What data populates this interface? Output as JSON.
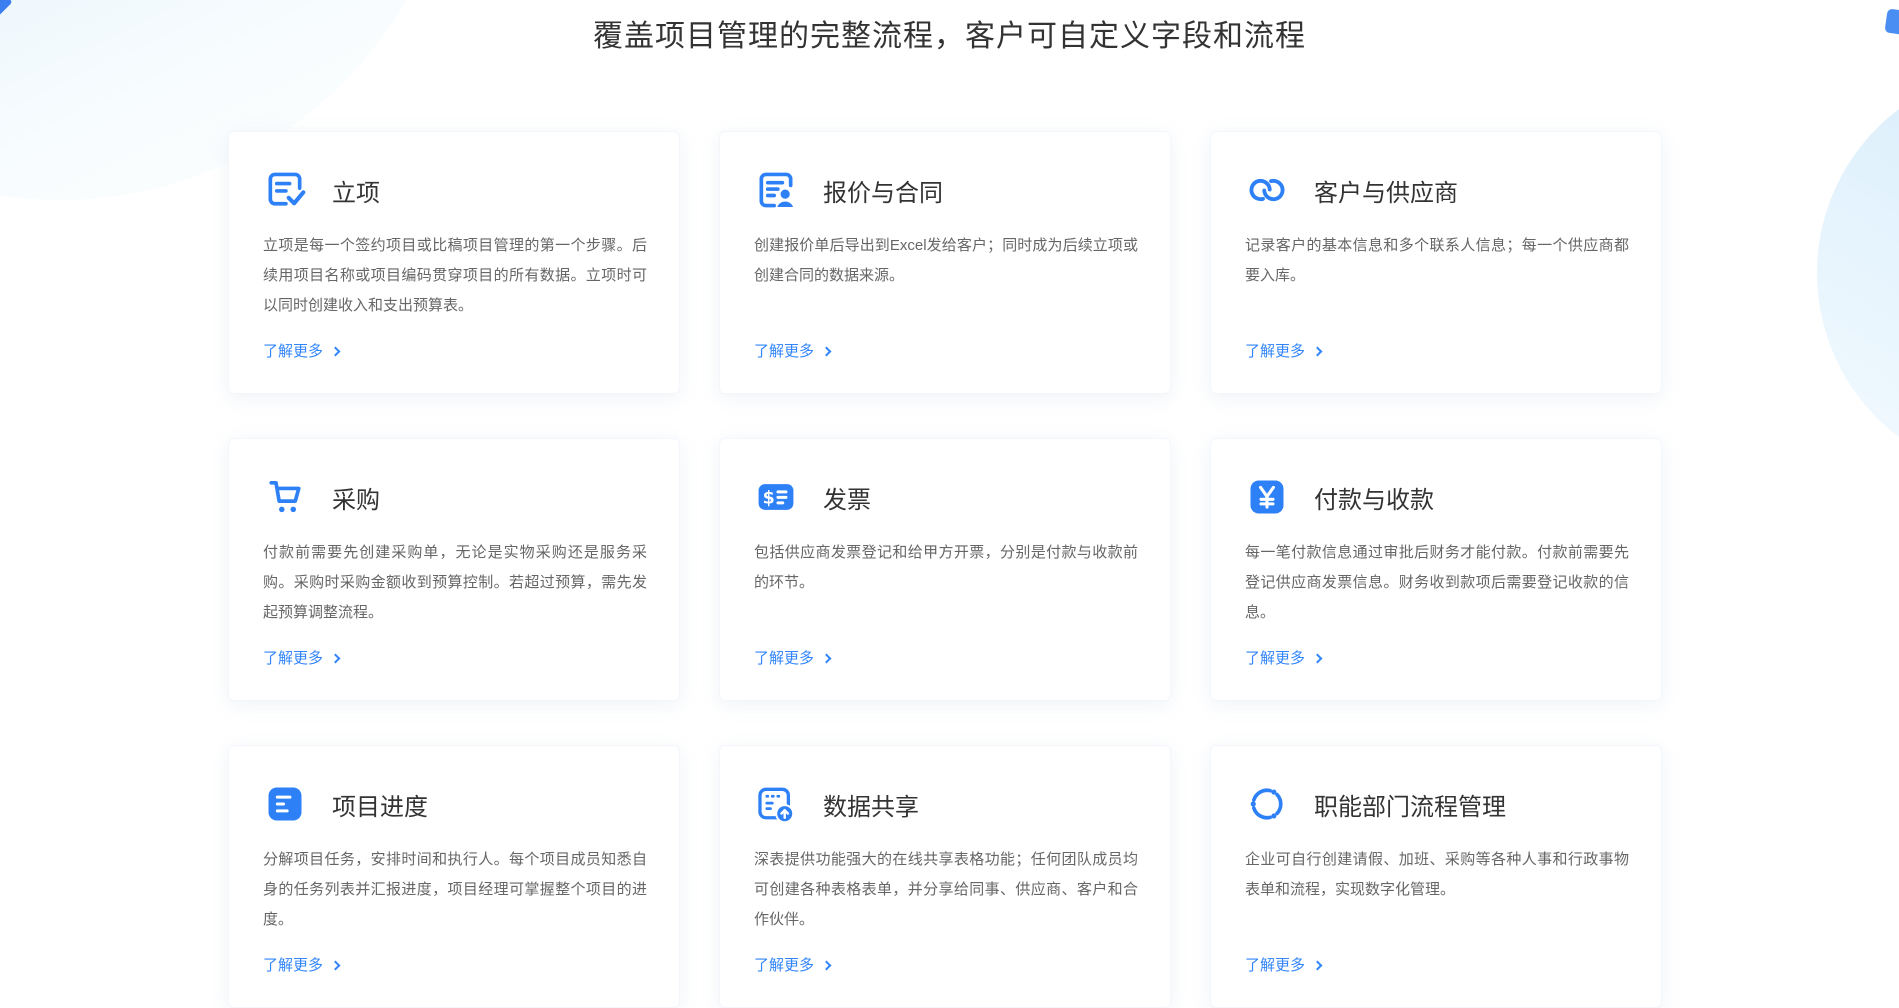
{
  "page_title": "覆盖项目管理的完整流程，客户可自定义字段和流程",
  "strings": {
    "more": "了解更多"
  },
  "colors": {
    "accent": "#2e80f7",
    "link": "#3285fb",
    "title_text": "#333333",
    "body_text": "#666666",
    "bg_circle": "#ddeefb"
  },
  "cards": [
    {
      "icon": "doc-check-icon",
      "title": "立项",
      "desc": "立项是每一个签约项目或比稿项目管理的第一个步骤。后续用项目名称或项目编码贯穿项目的所有数据。立项时可以同时创建收入和支出预算表。"
    },
    {
      "icon": "doc-person-icon",
      "title": "报价与合同",
      "desc": "创建报价单后导出到Excel发给客户；同时成为后续立项或创建合同的数据来源。"
    },
    {
      "icon": "link-rings-icon",
      "title": "客户与供应商",
      "desc": "记录客户的基本信息和多个联系人信息；每一个供应商都要入库。"
    },
    {
      "icon": "cart-icon",
      "title": "采购",
      "desc": "付款前需要先创建采购单，无论是实物采购还是服务采购。采购时采购金额收到预算控制。若超过预算，需先发起预算调整流程。"
    },
    {
      "icon": "invoice-icon",
      "title": "发票",
      "desc": "包括供应商发票登记和给甲方开票，分别是付款与收款前的环节。"
    },
    {
      "icon": "yuan-icon",
      "title": "付款与收款",
      "desc": "每一笔付款信息通过审批后财务才能付款。付款前需要先登记供应商发票信息。财务收到款项后需要登记收款的信息。"
    },
    {
      "icon": "task-list-icon",
      "title": "项目进度",
      "desc": "分解项目任务，安排时间和执行人。每个项目成员知悉自身的任务列表并汇报进度，项目经理可掌握整个项目的进度。"
    },
    {
      "icon": "share-table-icon",
      "title": "数据共享",
      "desc": "深表提供功能强大的在线共享表格功能；任何团队成员均可创建各种表格表单，并分享给同事、供应商、客户和合作伙伴。"
    },
    {
      "icon": "workflow-circle-icon",
      "title": "职能部门流程管理",
      "desc": "企业可自行创建请假、加班、采购等各种人事和行政事物表单和流程，实现数字化管理。"
    }
  ]
}
